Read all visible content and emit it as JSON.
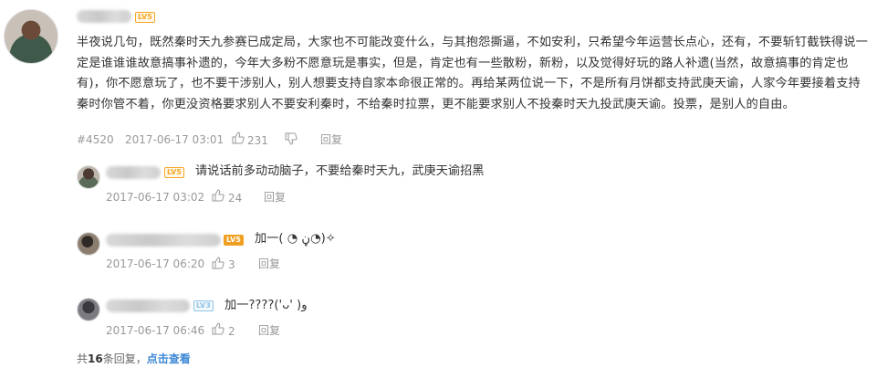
{
  "main_comment": {
    "level_badge": "LV5",
    "text": "半夜说几句，既然秦时天九参赛已成定局，大家也不可能改变什么，与其抱怨撕逼，不如安利，只希望今年运营长点心，还有，不要斩钉截铁得说一定是谁谁谁故意搞事补遗的，今年大多粉不愿意玩是事实，但是，肯定也有一些散粉，新粉，以及觉得好玩的路人补遗(当然，故意搞事的肯定也有)，你不愿意玩了，也不要干涉别人，别人想要支持自家本命很正常的。再给某两位说一下，不是所有月饼都支持武庚天谕，人家今年要接着支持秦时你管不着，你更没资格要求别人不要安利秦时，不给秦时拉票，更不能要求别人不投秦时天九投武庚天谕。投票，是别人的自由。",
    "floor": "#4520",
    "time": "2017-06-17 03:01",
    "likes": "231",
    "reply_label": "回复"
  },
  "replies": [
    {
      "level_badge": "LV5",
      "text": "请说话前多动动脑子，不要给秦时天九，武庚天谕招黑",
      "time": "2017-06-17 03:02",
      "likes": "24",
      "reply_label": "回复"
    },
    {
      "level_badge": "LV5",
      "text": "加一( ◔ ڼ◔)✧",
      "time": "2017-06-17 06:20",
      "likes": "3",
      "reply_label": "回复"
    },
    {
      "level_badge": "LV3",
      "text": "加一????('ᴗ' )و",
      "time": "2017-06-17 06:46",
      "likes": "2",
      "reply_label": "回复"
    }
  ],
  "footer": {
    "prefix": "共",
    "count": "16",
    "suffix": "条回复，",
    "view_link": "点击查看"
  },
  "colors": {
    "link": "#3d88d6",
    "meta": "#999999",
    "badge_orange": "#f5a623",
    "badge_blue": "#8fc3e8"
  }
}
